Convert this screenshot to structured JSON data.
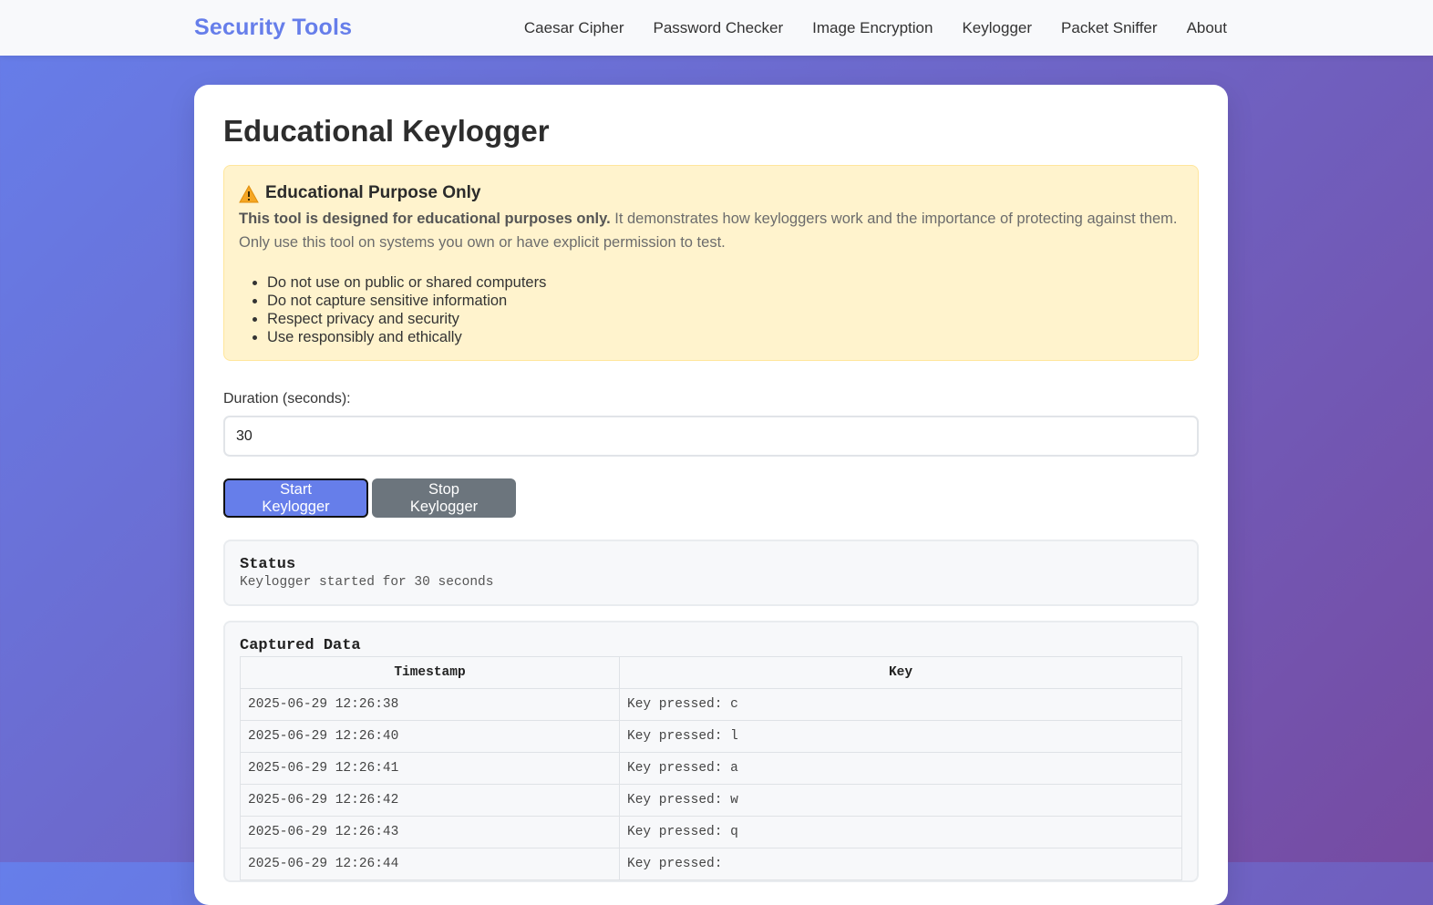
{
  "nav": {
    "brand": "Security Tools",
    "links": [
      "Caesar Cipher",
      "Password Checker",
      "Image Encryption",
      "Keylogger",
      "Packet Sniffer",
      "About"
    ]
  },
  "page": {
    "title": "Educational Keylogger"
  },
  "warning": {
    "icon": "warning-icon",
    "title": "Educational Purpose Only",
    "bold_text": "This tool is designed for educational purposes only.",
    "text": " It demonstrates how keyloggers work and the importance of protecting against them. Only use this tool on systems you own or have explicit permission to test.",
    "bullets": [
      "Do not use on public or shared computers",
      "Do not capture sensitive information",
      "Respect privacy and security",
      "Use responsibly and ethically"
    ]
  },
  "form": {
    "duration_label": "Duration (seconds):",
    "duration_value": "30"
  },
  "buttons": {
    "start": "Start Keylogger",
    "stop": "Stop Keylogger"
  },
  "status": {
    "title": "Status",
    "text": "Keylogger started for 30 seconds"
  },
  "captured": {
    "title": "Captured Data",
    "headers": [
      "Timestamp",
      "Key"
    ],
    "rows": [
      [
        "2025-06-29 12:26:38",
        "Key pressed: c"
      ],
      [
        "2025-06-29 12:26:40",
        "Key pressed: l"
      ],
      [
        "2025-06-29 12:26:41",
        "Key pressed: a"
      ],
      [
        "2025-06-29 12:26:42",
        "Key pressed: w"
      ],
      [
        "2025-06-29 12:26:43",
        "Key pressed: q"
      ],
      [
        "2025-06-29 12:26:44",
        "Key pressed: "
      ]
    ]
  },
  "colors": {
    "accent": "#667eea",
    "gradient_end": "#764ba2",
    "warning_bg": "#fff3cd",
    "stop_button": "#6c757d"
  }
}
